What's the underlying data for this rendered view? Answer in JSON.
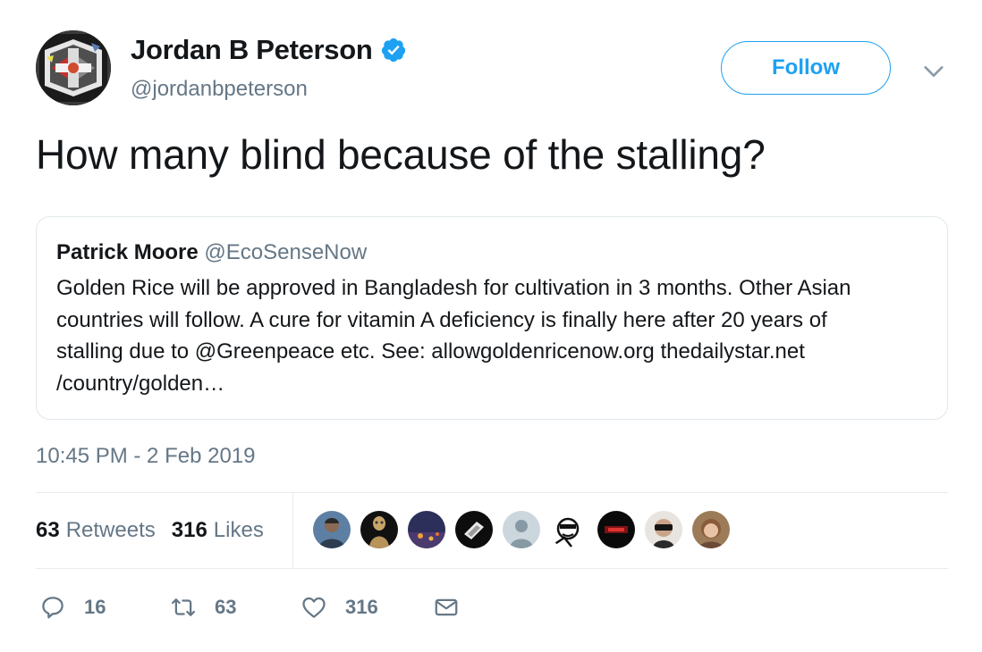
{
  "author": {
    "display_name": "Jordan B Peterson",
    "handle": "@jordanbpeterson",
    "verified_icon": "verified-badge-icon",
    "avatar_icon": "abstract-logo-avatar"
  },
  "follow_label": "Follow",
  "menu_icon": "chevron-down-icon",
  "tweet_text": "How many blind because of the stalling?",
  "quoted_tweet": {
    "name": "Patrick Moore",
    "handle": "@EcoSenseNow",
    "lines": [
      "Golden Rice will be approved in Bangladesh for cultivation in 3 months. Other Asian",
      "countries will follow. A cure for vitamin A deficiency is finally here after 20 years of",
      "stalling due to @Greenpeace etc. See: allowgoldenricenow.org thedailystar.net",
      "/country/golden…"
    ]
  },
  "timestamp": "10:45 PM - 2 Feb 2019",
  "stats": {
    "retweets_count": "63",
    "retweets_label": "Retweets",
    "likes_count": "316",
    "likes_label": "Likes"
  },
  "likers_count": 9,
  "actions": {
    "reply_count": "16",
    "retweet_count": "63",
    "like_count": "316"
  },
  "colors": {
    "accent": "#1da1f2",
    "secondary_text": "#657786",
    "border": "#e1e8ed"
  }
}
